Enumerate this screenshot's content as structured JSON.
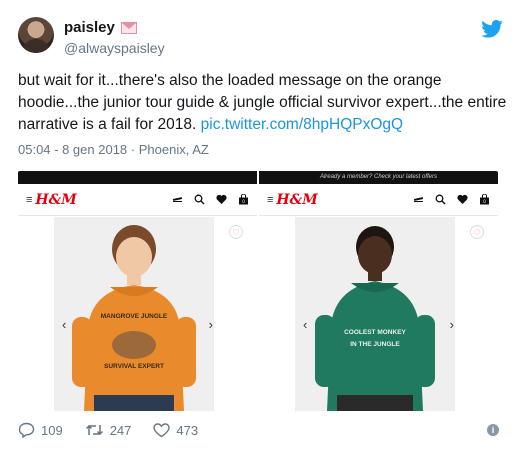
{
  "author": {
    "display_name": "paisley",
    "handle": "@alwayspaisley",
    "badge": "envelope-heart-icon"
  },
  "tweet": {
    "text": "but wait for it...there's also the loaded message on the orange hoodie...the junior tour guide & jungle official survivor expert...the entire narrative is a fail for 2018. ",
    "link": "pic.twitter.com/8hpHQPxOgQ",
    "timestamp": "05:04 - 8 gen 2018",
    "separator": "·",
    "location": "Phoenix, AZ"
  },
  "media": {
    "panels": [
      {
        "topbar": "",
        "logo": "H&M",
        "menu_icon": "≡",
        "hoodie_color": "#e98a2c",
        "hoodie_text_top": "MANGROVE JUNGLE",
        "hoodie_text_bottom": "SURVIVAL EXPERT",
        "left_arrow": "‹",
        "right_arrow": "›",
        "heart": "♡"
      },
      {
        "topbar": "Already a member? Check your latest offers",
        "logo": "H&M",
        "menu_icon": "≡",
        "hoodie_color": "#1f7a5f",
        "hoodie_text_top": "COOLEST MONKEY",
        "hoodie_text_bottom": "IN THE JUNGLE",
        "left_arrow": "‹",
        "right_arrow": "›",
        "heart": "♡"
      }
    ]
  },
  "actions": {
    "replies": "109",
    "retweets": "247",
    "likes": "473"
  },
  "colors": {
    "link": "#1b95e0",
    "muted": "#657786",
    "twitter_blue": "#1da1f2",
    "hm_red": "#e50010"
  }
}
